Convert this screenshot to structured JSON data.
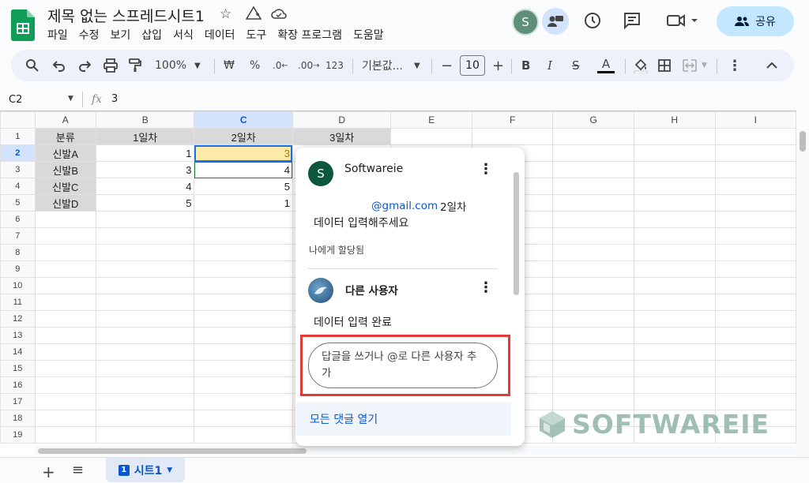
{
  "header": {
    "title": "제목 없는 스프레드시트1",
    "menu": [
      "파일",
      "수정",
      "보기",
      "삽입",
      "서식",
      "데이터",
      "도구",
      "확장 프로그램",
      "도움말"
    ],
    "avatar_letter": "S",
    "share_label": "공유",
    "colors": {
      "share_bg": "#c2e7ff",
      "logo": "#0f9d58"
    }
  },
  "toolbar": {
    "zoom": "100%",
    "currency": "₩",
    "percent": "%",
    "dec_decrease": ".0",
    "dec_increase": ".00",
    "format_123": "123",
    "font": "기본값...",
    "font_size": "10",
    "bold": "B",
    "italic": "I",
    "strike": "S",
    "text_color": "A"
  },
  "formula_bar": {
    "cell_ref": "C2",
    "fx": "fx",
    "value": "3"
  },
  "sheet": {
    "columns": [
      "A",
      "B",
      "C",
      "D",
      "E",
      "F",
      "G",
      "H",
      "I"
    ],
    "rows": [
      [
        "분류",
        "1일차",
        "2일차",
        "3일차",
        "",
        "",
        "",
        "",
        ""
      ],
      [
        "신발A",
        "1",
        "3",
        "",
        "",
        "",
        "",
        "",
        ""
      ],
      [
        "신발B",
        "3",
        "4",
        "",
        "",
        "",
        "",
        "",
        ""
      ],
      [
        "신발C",
        "4",
        "5",
        "",
        "",
        "",
        "",
        "",
        ""
      ],
      [
        "신발D",
        "5",
        "1",
        "",
        "",
        "",
        "",
        "",
        ""
      ],
      [
        "",
        "",
        "",
        "",
        "",
        "",
        "",
        "",
        ""
      ],
      [
        "",
        "",
        "",
        "",
        "",
        "",
        "",
        "",
        ""
      ],
      [
        "",
        "",
        "",
        "",
        "",
        "",
        "",
        "",
        ""
      ],
      [
        "",
        "",
        "",
        "",
        "",
        "",
        "",
        "",
        ""
      ],
      [
        "",
        "",
        "",
        "",
        "",
        "",
        "",
        "",
        ""
      ],
      [
        "",
        "",
        "",
        "",
        "",
        "",
        "",
        "",
        ""
      ],
      [
        "",
        "",
        "",
        "",
        "",
        "",
        "",
        "",
        ""
      ],
      [
        "",
        "",
        "",
        "",
        "",
        "",
        "",
        "",
        ""
      ],
      [
        "",
        "",
        "",
        "",
        "",
        "",
        "",
        "",
        ""
      ],
      [
        "",
        "",
        "",
        "",
        "",
        "",
        "",
        "",
        ""
      ],
      [
        "",
        "",
        "",
        "",
        "",
        "",
        "",
        "",
        ""
      ],
      [
        "",
        "",
        "",
        "",
        "",
        "",
        "",
        "",
        ""
      ],
      [
        "",
        "",
        "",
        "",
        "",
        "",
        "",
        "",
        ""
      ],
      [
        "",
        "",
        "",
        "",
        "",
        "",
        "",
        "",
        ""
      ]
    ],
    "row_numbers": [
      "1",
      "2",
      "3",
      "4",
      "5",
      "6",
      "7",
      "8",
      "9",
      "10",
      "11",
      "12",
      "13",
      "14",
      "15",
      "16",
      "17",
      "18",
      "19"
    ],
    "selected_cell": "C2"
  },
  "comments": {
    "thread1": {
      "author": "Softwareie",
      "avatar_letter": "S",
      "mention": "@gmail.com",
      "mention_suffix": "2일차",
      "text": "데이터 입력해주세요",
      "assigned": "나에게 할당됨"
    },
    "thread2": {
      "author": "다른 사용자",
      "text": "데이터 입력 완료"
    },
    "reply_placeholder": "답글을 쓰거나 @로 다른 사용자 추가",
    "open_all": "모든 댓글 열기"
  },
  "bottom": {
    "sheet_tab": "시트1",
    "sheet_tab_number": "1"
  },
  "watermark": "SOFTWAREIE"
}
